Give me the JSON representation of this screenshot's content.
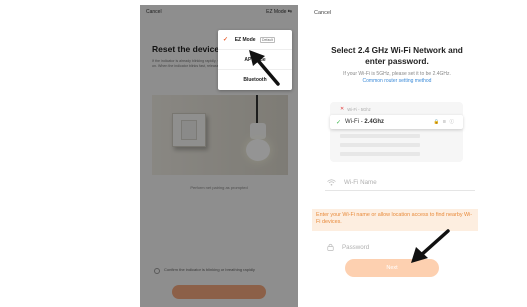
{
  "left_screen": {
    "cancel_label": "Cancel",
    "mode_button_label": "EZ Mode",
    "title": "Reset the device fir",
    "description": "If the indicator is already blinking rapidly, skip this step. Turn the device on, off, on, off, on. When the indicator blinks fast, release. The user manual provides...",
    "pairing_note": "Perform net pairing as prompted",
    "confirm_text": "Confirm the indicator is blinking or breathing rapidly",
    "next_label": ""
  },
  "mode_menu": {
    "items": [
      {
        "label": "EZ Mode",
        "badge": "Default",
        "selected": true
      },
      {
        "label": "AP Mode",
        "badge": "",
        "selected": false
      },
      {
        "label": "Bluetooth",
        "badge": "",
        "selected": false
      }
    ]
  },
  "right_screen": {
    "cancel_label": "Cancel",
    "title_line1": "Select 2.4 GHz Wi-Fi Network and",
    "title_line2": "enter password.",
    "subtitle": "If your Wi-Fi is 5GHz, please set it to be 2.4GHz.",
    "subtitle_link": "Common router setting method",
    "networks": [
      {
        "label": "Wi-Fi - 5Ghz",
        "status": "unsupported"
      },
      {
        "label": "Wi-Fi - ",
        "label_bold": "2.4Ghz",
        "status": "supported"
      }
    ],
    "wifi_placeholder": "Wi-Fi Name",
    "warning_text": "Enter your Wi-Fi name or allow location access to find nearby Wi-Fi devices.",
    "password_placeholder": "Password",
    "next_label": "Next"
  },
  "colors": {
    "accent": "#e85c2c",
    "next_button": "#fdd0b0",
    "warning_bg": "#fdeee0",
    "warning_text": "#e88a3a",
    "link": "#3a8ad8",
    "success": "#39b54a",
    "error": "#e23b3b"
  }
}
